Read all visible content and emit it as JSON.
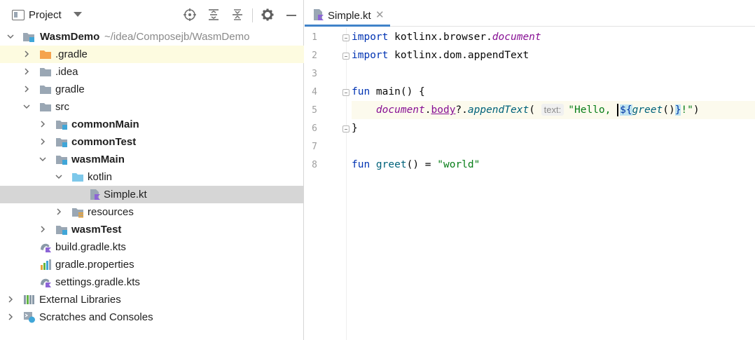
{
  "project_panel": {
    "title": "Project",
    "toolbar_icons": [
      "locate-icon",
      "expand-all-icon",
      "collapse-all-icon",
      "gear-icon",
      "minimize-icon"
    ],
    "tree": [
      {
        "label": "WasmDemo",
        "path": "~/idea/Composejb/WasmDemo",
        "bold": true,
        "expanded": true,
        "icon": "module-folder-icon"
      },
      {
        "label": ".gradle",
        "expanded": false,
        "icon": "orange-folder-icon"
      },
      {
        "label": ".idea",
        "expanded": false,
        "icon": "folder-icon"
      },
      {
        "label": "gradle",
        "expanded": false,
        "icon": "folder-icon"
      },
      {
        "label": "src",
        "expanded": true,
        "icon": "folder-icon"
      },
      {
        "label": "commonMain",
        "bold": true,
        "expanded": false,
        "icon": "module-folder-icon"
      },
      {
        "label": "commonTest",
        "bold": true,
        "expanded": false,
        "icon": "module-folder-icon"
      },
      {
        "label": "wasmMain",
        "bold": true,
        "expanded": true,
        "icon": "module-folder-icon"
      },
      {
        "label": "kotlin",
        "expanded": true,
        "icon": "source-folder-icon"
      },
      {
        "label": "Simple.kt",
        "selected": true,
        "icon": "kotlin-file-icon"
      },
      {
        "label": "resources",
        "expanded": false,
        "icon": "resources-folder-icon"
      },
      {
        "label": "wasmTest",
        "bold": true,
        "expanded": false,
        "icon": "module-folder-icon"
      },
      {
        "label": "build.gradle.kts",
        "icon": "gradle-kts-icon"
      },
      {
        "label": "gradle.properties",
        "icon": "properties-icon"
      },
      {
        "label": "settings.gradle.kts",
        "icon": "gradle-kts-icon"
      },
      {
        "label": "External Libraries",
        "expanded": false,
        "icon": "libraries-icon"
      },
      {
        "label": "Scratches and Consoles",
        "expanded": false,
        "icon": "scratches-icon"
      }
    ]
  },
  "editor": {
    "tab": {
      "label": "Simple.kt",
      "close": "✕"
    },
    "line_numbers": [
      "1",
      "2",
      "3",
      "4",
      "5",
      "6",
      "7",
      "8"
    ],
    "code": {
      "l1_kw": "import",
      "l1_pkg": " kotlinx.browser.",
      "l1_doc": "document",
      "l2_kw": "import",
      "l2_rest": " kotlinx.dom.appendText",
      "l4_kw": "fun",
      "l4_rest": " main() {",
      "l5_doc": "document",
      "l5_dot": ".",
      "l5_body": "body",
      "l5_safe": "?.",
      "l5_append": "appendText",
      "l5_paren": "(",
      "l5_hint": "text:",
      "l5_str1": "\"Hello, ",
      "l5_tmpl_open": "${",
      "l5_greet": "greet",
      "l5_parens": "()",
      "l5_tmpl_close": "}",
      "l5_str2": "!\"",
      "l5_end": ")",
      "l6": "}",
      "l8_kw": "fun",
      "l8_name": " greet",
      "l8_rest": "() = ",
      "l8_str": "\"world\""
    }
  },
  "colors": {
    "keyword": "#0033b3",
    "string": "#067d17",
    "accent": "#4083c9",
    "selection": "#d6d6d6"
  }
}
